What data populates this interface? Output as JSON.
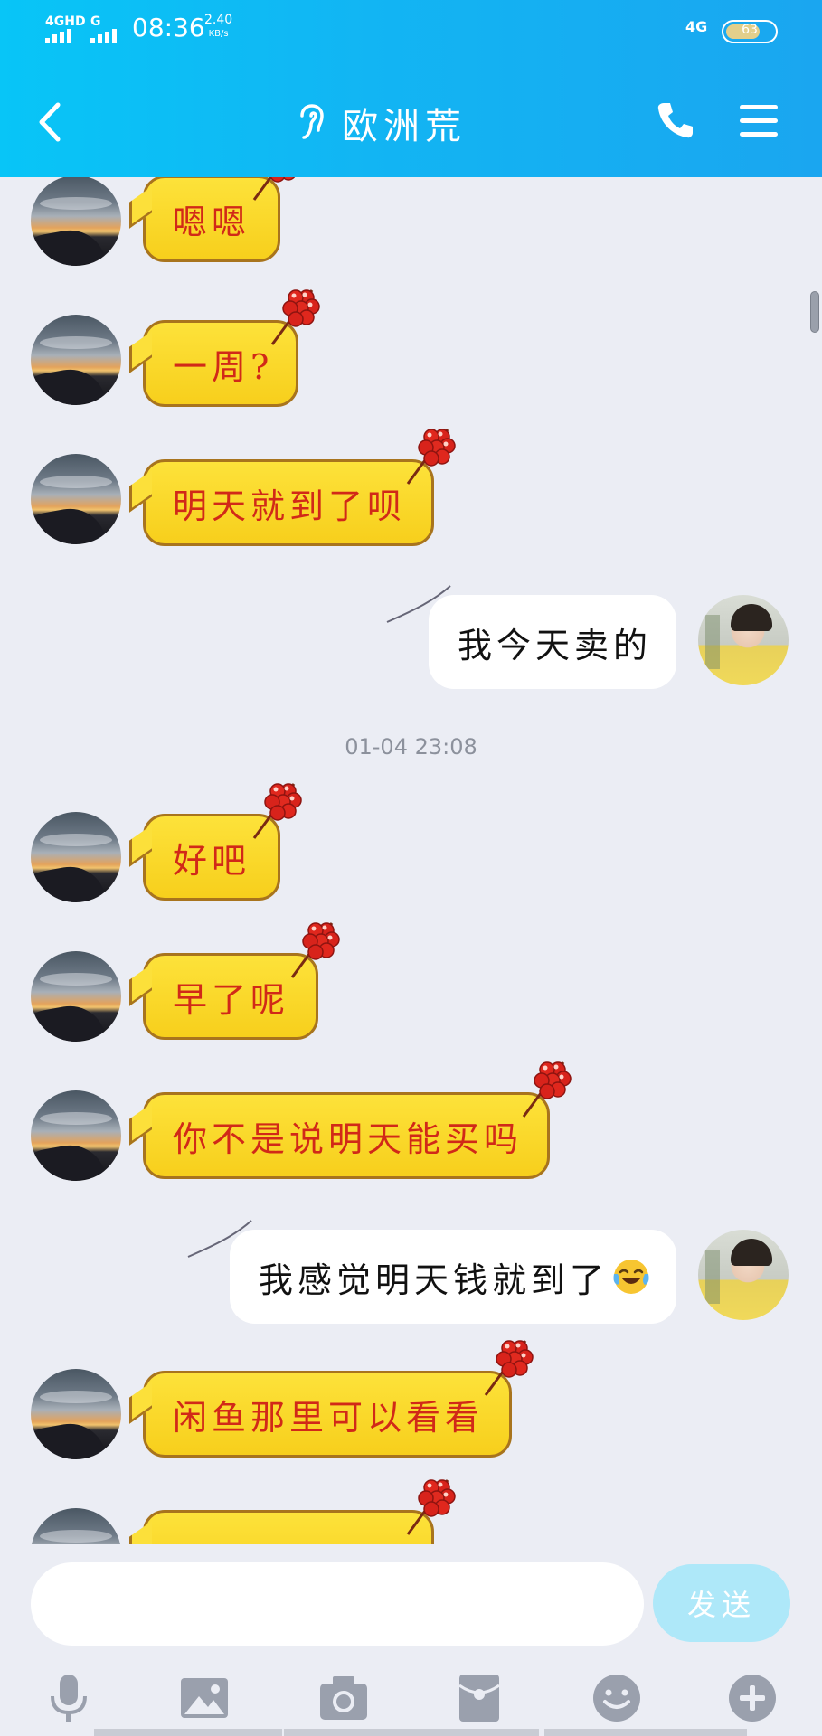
{
  "status_bar": {
    "signal1_label": "4GHD",
    "signal2_label": "G",
    "time": "08:36",
    "net_speed_value": "2.40",
    "net_speed_unit": "KB/s",
    "network": "4G",
    "battery": "63"
  },
  "header": {
    "title": "欧洲荒"
  },
  "messages": {
    "m1": "嗯嗯",
    "m2": "一周?",
    "m3": "明天就到了呗",
    "m4": "我今天卖的",
    "timestamp": "01-04 23:08",
    "m5": "好吧",
    "m6": "早了呢",
    "m7": "你不是说明天能买吗",
    "m8": "我感觉明天钱就到了",
    "m9": "闲鱼那里可以看看"
  },
  "composer": {
    "placeholder": "",
    "send_label": "发送"
  },
  "colors": {
    "header": "#12b5f3",
    "incoming_bubble": "#fce03a",
    "incoming_text": "#d12918",
    "send_button": "#aee8f9"
  },
  "icons": {
    "back": "chevron-left-icon",
    "ear": "ear-icon",
    "phone": "phone-icon",
    "menu": "menu-icon",
    "toolbar": [
      "microphone-icon",
      "image-icon",
      "camera-icon",
      "red-packet-icon",
      "emoji-icon",
      "plus-icon"
    ]
  }
}
